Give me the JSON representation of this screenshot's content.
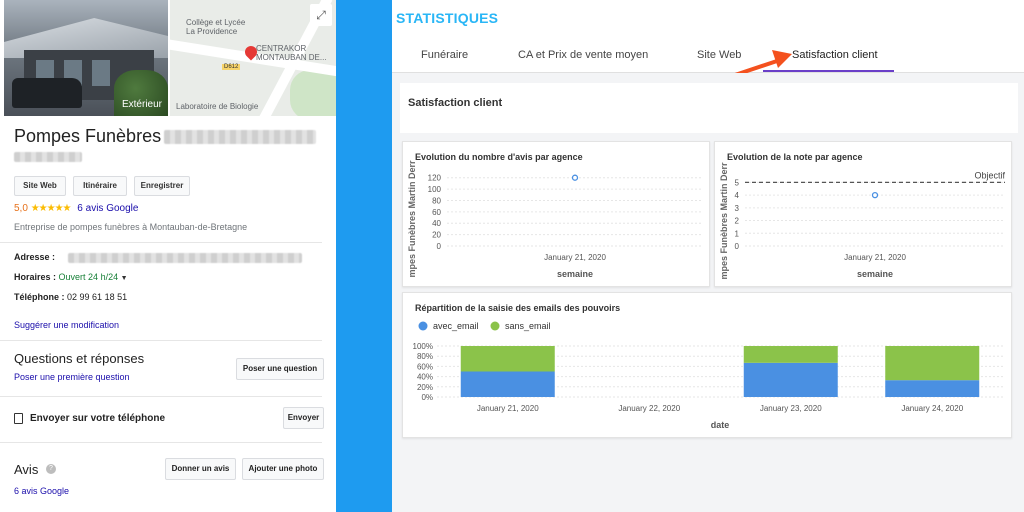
{
  "left_panel": {
    "photo_label": "Extérieur",
    "map_labels": {
      "college": "Collège et Lycée\nLa Providence",
      "centrakor": "CENTRAKOR\nMONTAUBAN DE...",
      "road": "D612",
      "lab": "Laboratoire de Biologie"
    },
    "business_name": "Pompes Funèbres",
    "buttons": [
      "Site Web",
      "Itinéraire",
      "Enregistrer"
    ],
    "rating": "5,0",
    "stars": "★★★★★",
    "reviews_link": "6 avis Google",
    "category": "Entreprise de pompes funèbres à Montauban-de-Bretagne",
    "address_label": "Adresse :",
    "hours_label": "Horaires :",
    "hours_value": "Ouvert 24 h/24",
    "phone_label": "Téléphone :",
    "phone_value": "02 99 61 18 51",
    "suggest_link": "Suggérer une modification",
    "qa_title": "Questions et réponses",
    "qa_link": "Poser une première question",
    "ask_button": "Poser une question",
    "send_label": "Envoyer sur votre téléphone",
    "send_button": "Envoyer",
    "avis_title": "Avis",
    "give_review_button": "Donner un avis",
    "add_photo_button": "Ajouter une photo",
    "avis_link": "6 avis Google"
  },
  "dashboard": {
    "title": "STATISTIQUES",
    "tabs": [
      "Funéraire",
      "CA et Prix de vente moyen",
      "Site Web",
      "Satisfaction client"
    ],
    "active_tab": "Satisfaction client",
    "section_title": "Satisfaction client",
    "colors": {
      "accent_title": "#29b6f6",
      "tab_underline": "#6a3fc8",
      "arrow": "#f4511e",
      "avec_email": "#4a90e2",
      "sans_email": "#8bc34a",
      "point": "#4a90e2"
    }
  },
  "chart_data": [
    {
      "type": "scatter",
      "title": "Evolution du nombre d'avis par agence",
      "xlabel": "semaine",
      "ylabel": "mpes Funèbres Martin Derr",
      "x": [
        "January 21, 2020"
      ],
      "y": [
        120
      ],
      "yticks": [
        0,
        20,
        40,
        60,
        80,
        100,
        120
      ],
      "ylim": [
        0,
        130
      ],
      "grid": true
    },
    {
      "type": "scatter",
      "title": "Evolution de la note par agence",
      "xlabel": "semaine",
      "ylabel": "mpes Funèbres Martin Derr",
      "x": [
        "January 21, 2020"
      ],
      "y": [
        4
      ],
      "yticks": [
        0,
        1,
        2,
        3,
        4,
        5
      ],
      "ylim": [
        0,
        5.5
      ],
      "reference_line": {
        "label": "Objectif",
        "value": 5
      },
      "grid": true
    },
    {
      "type": "bar",
      "stacked": true,
      "title": "Répartition de la saisie des emails des pouvoirs",
      "xlabel": "date",
      "categories": [
        "January 21, 2020",
        "January 22, 2020",
        "January 23, 2020",
        "January 24, 2020"
      ],
      "series": [
        {
          "name": "avec_email",
          "values": [
            50,
            0,
            67,
            33
          ]
        },
        {
          "name": "sans_email",
          "values": [
            50,
            0,
            33,
            67
          ]
        }
      ],
      "yticks": [
        "0%",
        "20%",
        "40%",
        "60%",
        "80%",
        "100%"
      ],
      "ylim": [
        0,
        100
      ],
      "legend": "top-left",
      "grid": true
    }
  ]
}
